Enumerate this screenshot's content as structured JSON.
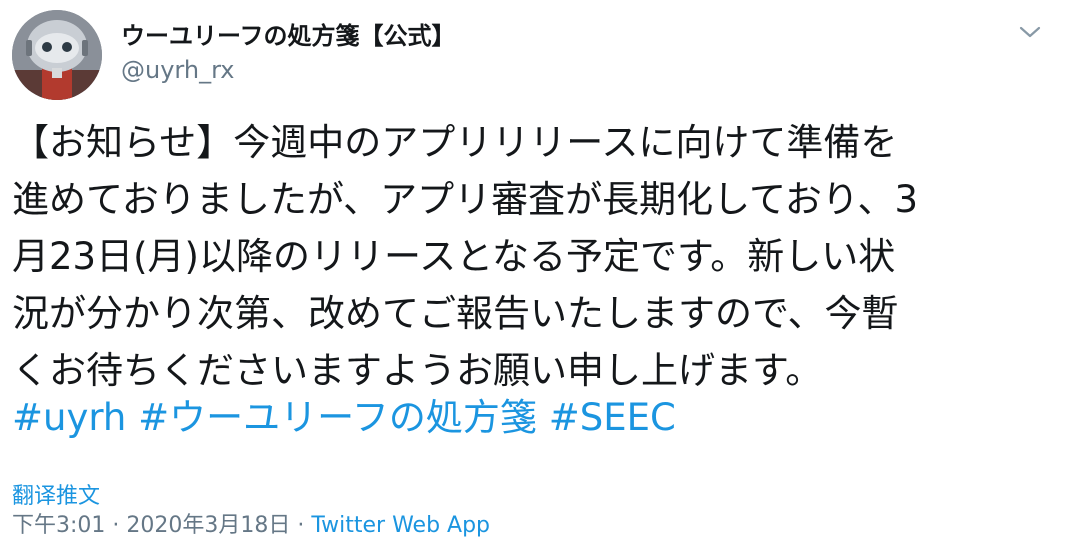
{
  "author": {
    "display_name": "ウーユリーフの処方箋【公式】",
    "handle": "@uyrh_rx"
  },
  "icons": {
    "avatar": "robot-avatar",
    "menu": "chevron-down-icon"
  },
  "tweet": {
    "lines": [
      "【お知らせ】今週中のアプリリリースに向けて準備を",
      "進めておりましたが、アプリ審査が長期化しており、3",
      "月23日(月)以降のリリースとなる予定です。新しい状",
      "況が分かり次第、改めてご報告いたしますので、今暫",
      "くお待ちくださいますようお願い申し上げます。"
    ],
    "hashtags": [
      "#uyrh",
      "#ウーユリーフの処方箋",
      "#SEEC"
    ]
  },
  "translate_label": "翻译推文",
  "meta": {
    "time": "下午3:01 · 2020年3月18日 · ",
    "client": "Twitter Web App"
  },
  "colors": {
    "link": "#1b95e0",
    "secondary": "#657786",
    "text": "#14171a"
  }
}
